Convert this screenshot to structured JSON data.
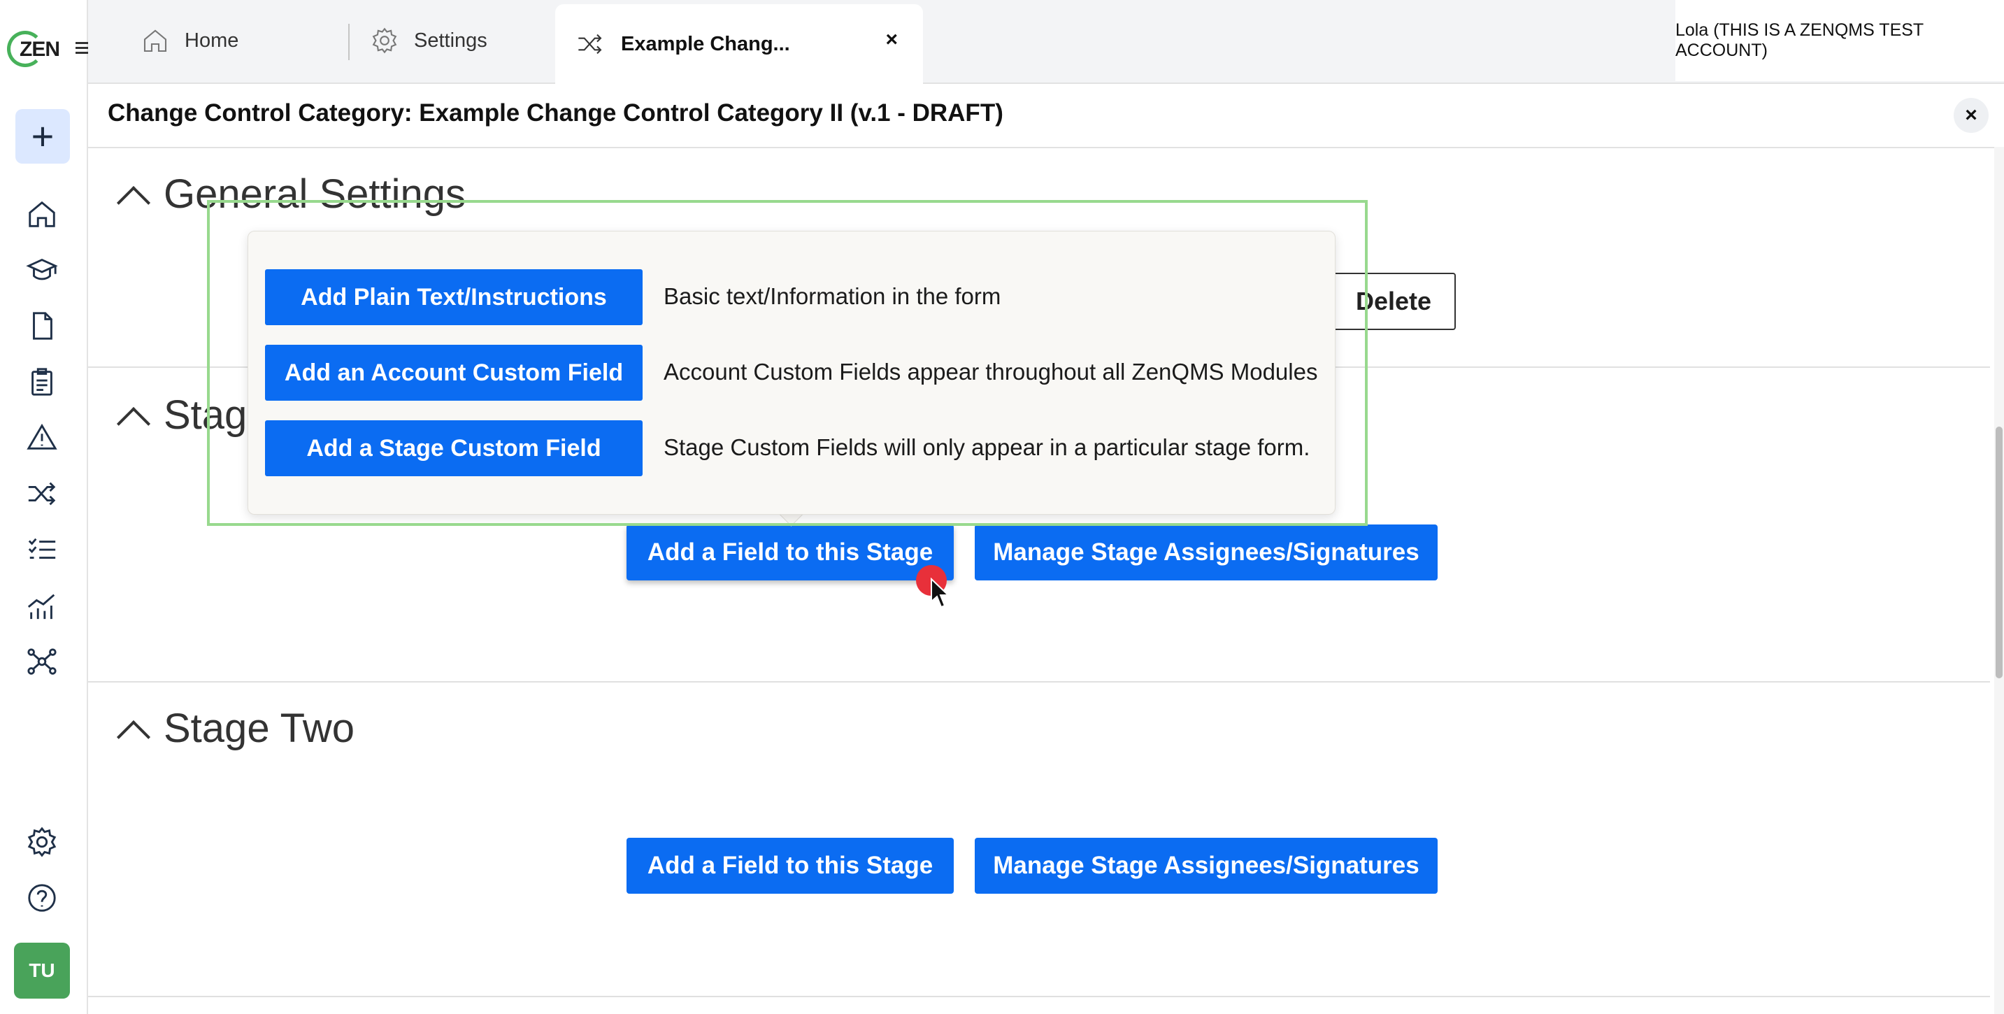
{
  "sidebar": {
    "logo_text": "ZEN",
    "new_button": "+",
    "avatar_initials": "TU",
    "nav_icons": [
      "home-icon",
      "training-icon",
      "document-icon",
      "clipboard-icon",
      "warning-icon",
      "shuffle-icon",
      "checklist-icon",
      "analytics-icon",
      "network-icon"
    ],
    "bottom_icons": [
      "gear-icon",
      "help-icon"
    ]
  },
  "topbar": {
    "tabs": [
      {
        "label": "Home",
        "icon": "home-icon"
      },
      {
        "label": "Settings",
        "icon": "gear-icon"
      }
    ],
    "active_tab": {
      "label": "Example Chang...",
      "icon": "shuffle-icon",
      "close": "×"
    },
    "account": "Lola (THIS IS A ZENQMS TEST ACCOUNT)"
  },
  "header": {
    "title": "Change Control Category: Example Change Control Category II (v.1 - DRAFT)",
    "close": "×"
  },
  "sections": {
    "general": {
      "title": "General Settings",
      "delete_label": "Delete"
    },
    "stage_one": {
      "title_visible": "Stage",
      "add_field": "Add a Field to this Stage",
      "manage": "Manage Stage Assignees/Signatures"
    },
    "stage_two": {
      "title": "Stage Two",
      "add_field": "Add a Field to this Stage",
      "manage": "Manage Stage Assignees/Signatures"
    }
  },
  "popover": {
    "items": [
      {
        "button": "Add Plain Text/Instructions",
        "description": "Basic text/Information in the form"
      },
      {
        "button": "Add an Account Custom Field",
        "description": "Account Custom Fields appear throughout all ZenQMS Modules"
      },
      {
        "button": "Add a Stage Custom Field",
        "description": "Stage Custom Fields will only appear in a particular stage form."
      }
    ]
  },
  "colors": {
    "primary": "#0b6cf2",
    "highlight": "#98d98e",
    "avatar": "#49a35a",
    "click_marker": "#e8303a"
  }
}
